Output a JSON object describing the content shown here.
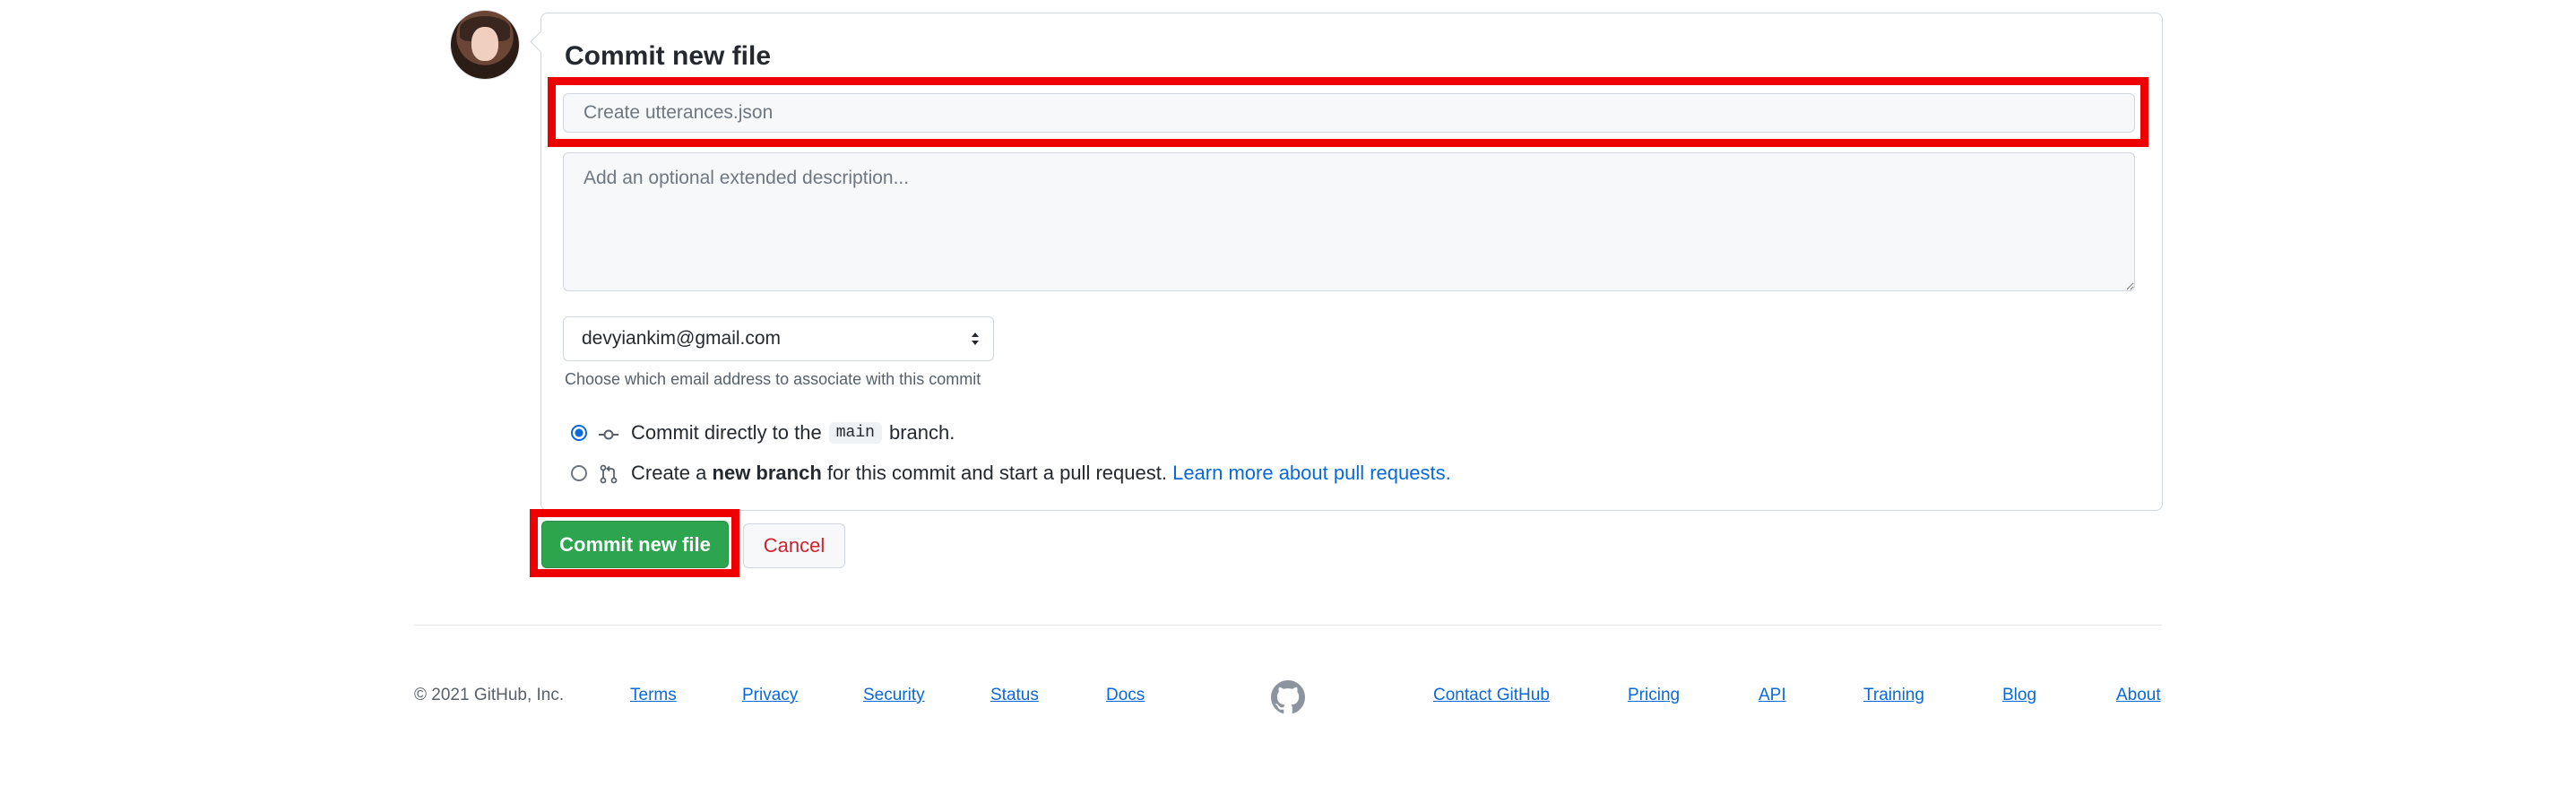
{
  "form": {
    "title": "Commit new file",
    "summary_placeholder": "Create utterances.json",
    "description_placeholder": "Add an optional extended description...",
    "email_value": "devyiankim@gmail.com",
    "email_note": "Choose which email address to associate with this commit",
    "option_direct": {
      "before": "Commit directly to the",
      "branch": "main",
      "after": "branch.",
      "checked": true
    },
    "option_new_branch": {
      "before": "Create a",
      "bold": "new branch",
      "after": "for this commit and start a pull request.",
      "link": "Learn more about pull requests.",
      "checked": false
    },
    "commit_button": "Commit new file",
    "cancel_button": "Cancel"
  },
  "footer": {
    "copyright": "© 2021 GitHub, Inc.",
    "left_links": [
      "Terms",
      "Privacy",
      "Security",
      "Status",
      "Docs"
    ],
    "right_links": [
      "Contact GitHub",
      "Pricing",
      "API",
      "Training",
      "Blog",
      "About"
    ]
  },
  "colors": {
    "primary_button": "#2da44e",
    "link": "#0969da",
    "cancel": "#cf222e",
    "highlight": "#ee0000"
  },
  "icons": {
    "commit_option": "git-commit-icon",
    "branch_option": "git-pull-request-icon",
    "footer_logo": "github-logo-icon",
    "select_arrows": "select-arrows-icon"
  }
}
